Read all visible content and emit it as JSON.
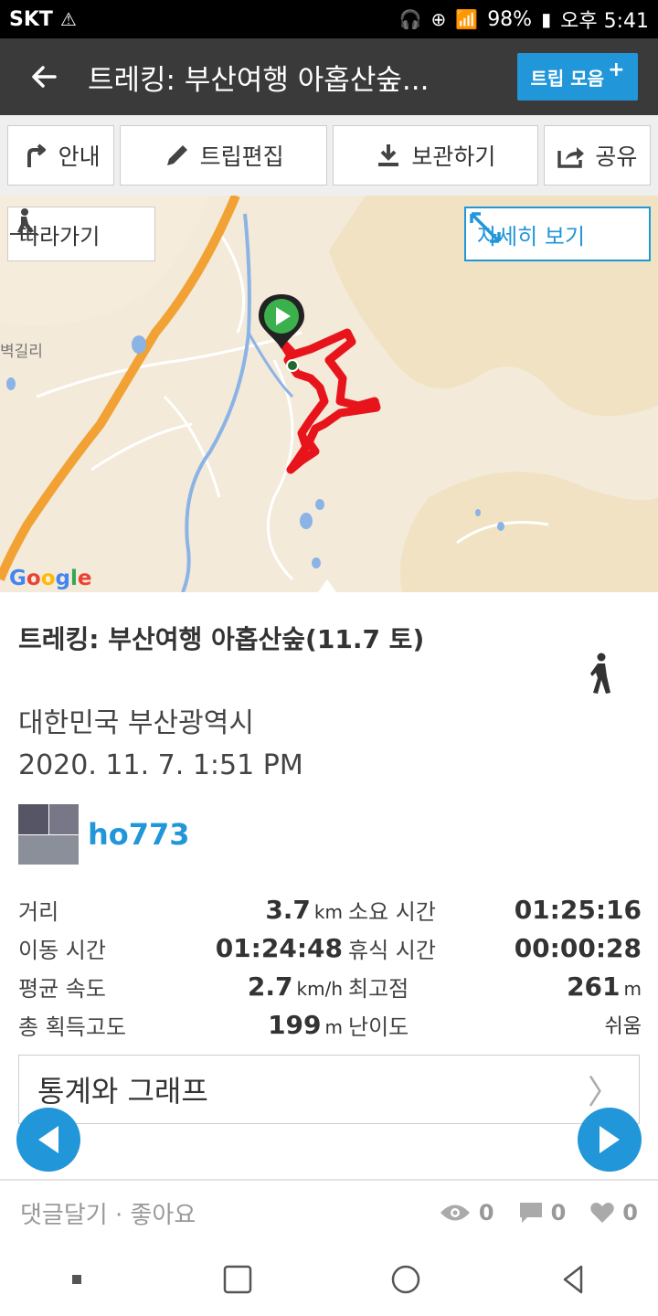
{
  "status": {
    "carrier": "SKT",
    "battery": "98%",
    "time": "오후 5:41"
  },
  "appbar": {
    "title": "트레킹: 부산여행 아홉산숲...",
    "trip_collection": "트립 모음"
  },
  "toolbar": {
    "guide": "안내",
    "edit": "트립편집",
    "save": "보관하기",
    "share": "공유"
  },
  "map": {
    "follow": "따라가기",
    "detail": "자세히 보기",
    "road_label": "벽길리",
    "attribution": "Google"
  },
  "trip": {
    "title": "트레킹: 부산여행 아홉산숲(11.7 토)",
    "location": "대한민국 부산광역시",
    "date": "2020. 11. 7. 1:51 PM",
    "user": "ho773"
  },
  "stats": {
    "distance_label": "거리",
    "distance_value": "3.7",
    "distance_unit": "km",
    "duration_label": "소요 시간",
    "duration_value": "01:25:16",
    "moving_label": "이동 시간",
    "moving_value": "01:24:48",
    "rest_label": "휴식 시간",
    "rest_value": "00:00:28",
    "speed_label": "평균 속도",
    "speed_value": "2.7",
    "speed_unit": "km/h",
    "max_label": "최고점",
    "max_value": "261",
    "max_unit": "m",
    "gain_label": "총 획득고도",
    "gain_value": "199",
    "gain_unit": "m",
    "difficulty_label": "난이도",
    "difficulty_value": "쉬움"
  },
  "graph_button": "통계와 그래프",
  "comment": {
    "label": "댓글달기 · 좋아요",
    "views": "0",
    "comments": "0",
    "likes": "0"
  },
  "colors": {
    "accent": "#2196d9",
    "appbar": "#3a3a3a",
    "track": "#e8141b"
  }
}
